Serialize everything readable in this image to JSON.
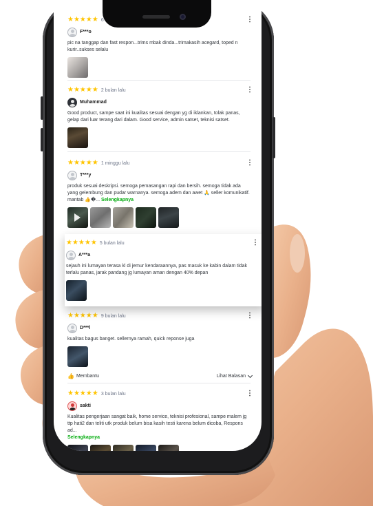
{
  "reviews": [
    {
      "stars": "★★★★★",
      "time": "6",
      "user": "F***o",
      "text": "pic na tanggap dan fast respon...trims mbak dinda...trimakasih acegard, toped n kurir..sukses selalu",
      "see_more": ""
    },
    {
      "stars": "★★★★★",
      "time": "2 bulan lalu",
      "user": "Muhammad",
      "text": "Good product, sampe saat ini kualitas sesuai dengan yg di iklankan, tolak panas, gelap dari luar terang dari dalam. Good service, admin satset, teknisi satset.",
      "see_more": ""
    },
    {
      "stars": "★★★★★",
      "time": "1 minggu lalu",
      "user": "T***y",
      "text": "produk sesuai deskripsi. semoga pemasangan rapi dan bersih. semoga tidak ada yang gelembung dan pudar warnanya. semoga adem dan awet 🙏 seller komunikatif. mantab 👍�...",
      "see_more": "Selengkapnya"
    },
    {
      "stars": "★★★★★",
      "time": "5 bulan lalu",
      "user": "A***a",
      "text": "sejauh ini lumayan terasa kl di jemur kendaraannya, pas masuk ke kabin dalam tidak terlalu panas, jarak pandang jg lumayan aman dengan 40% depan",
      "see_more": ""
    },
    {
      "stars": "★★★★★",
      "time": "9 bulan lalu",
      "user": "D***l",
      "text": "kualitas bagus banget. sellernya ramah, quick reponse juga",
      "see_more": "",
      "helpful": "Membantu",
      "reply": "Lihat Balasan"
    },
    {
      "stars": "★★★★★",
      "time": "3 bulan lalu",
      "user": "sakti",
      "text": "Kualitas pengerjaan sangat baik, home service, teknisi profesional, sampe malem jg ttp hati2 dan teliti utk produk belum bisa kasih testi karena belum dicoba, Respons ad...",
      "see_more": "Selengkapnya"
    }
  ],
  "colors": {
    "star": "#ffc400",
    "link": "#03ac0e",
    "text": "#31353b",
    "muted": "#6d7588"
  }
}
